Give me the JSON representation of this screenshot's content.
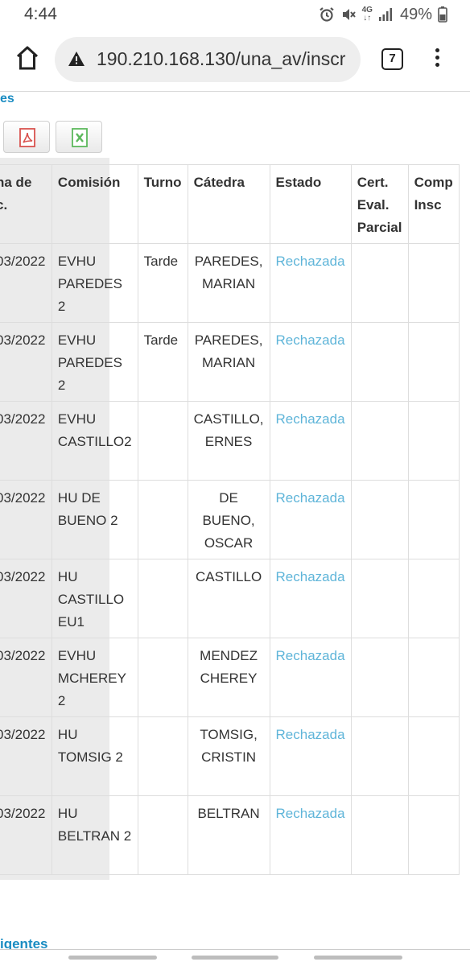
{
  "status_bar": {
    "time": "4:44",
    "network": "4G",
    "battery_percent": "49%",
    "icons": [
      "alarm-icon",
      "mute-icon",
      "network-4g-icon",
      "signal-icon",
      "battery-icon"
    ]
  },
  "browser": {
    "url": "190.210.168.130/una_av/inscr",
    "security_icon": "warning-triangle-icon",
    "tab_count": "7",
    "icons": [
      "home-icon",
      "tabs-icon",
      "more-vert-icon"
    ]
  },
  "page": {
    "top_link": "es",
    "bottom_link": "igentes",
    "export_buttons": [
      {
        "name": "pdf-export",
        "icon": "pdf-icon",
        "color": "#d9534f"
      },
      {
        "name": "excel-export",
        "icon": "excel-icon",
        "color": "#5cb85c"
      }
    ],
    "link_color": "#1a8cc2",
    "status_color": "#5fb5d9"
  },
  "table": {
    "headers": [
      "ha de\nc.",
      "Comisión",
      "Turno",
      "Cátedra",
      "Estado",
      "Cert.\nEval.\nParcial",
      "Comp\nInsc"
    ],
    "rows": [
      {
        "fecha": "03/2022",
        "comision": "EVHU PAREDES 2",
        "turno": "Tarde",
        "catedra": "PAREDES, MARIAN",
        "estado": "Rechazada",
        "cert": "",
        "comp": ""
      },
      {
        "fecha": "03/2022",
        "comision": "EVHU PAREDES 2",
        "turno": "Tarde",
        "catedra": "PAREDES, MARIAN",
        "estado": "Rechazada",
        "cert": "",
        "comp": ""
      },
      {
        "fecha": "03/2022",
        "comision": "EVHU CASTILLO2",
        "turno": "",
        "catedra": "CASTILLO, ERNES",
        "estado": "Rechazada",
        "cert": "",
        "comp": ""
      },
      {
        "fecha": "03/2022",
        "comision": "HU DE BUENO 2",
        "turno": "",
        "catedra": "DE BUENO, OSCAR",
        "estado": "Rechazada",
        "cert": "",
        "comp": ""
      },
      {
        "fecha": "03/2022",
        "comision": "HU CASTILLO EU1",
        "turno": "",
        "catedra": "CASTILLO",
        "estado": "Rechazada",
        "cert": "",
        "comp": ""
      },
      {
        "fecha": "03/2022",
        "comision": "EVHU MCHEREY 2",
        "turno": "",
        "catedra": "MENDEZ CHEREY",
        "estado": "Rechazada",
        "cert": "",
        "comp": ""
      },
      {
        "fecha": "03/2022",
        "comision": "HU TOMSIG 2",
        "turno": "",
        "catedra": "TOMSIG, CRISTIN",
        "estado": "Rechazada",
        "cert": "",
        "comp": ""
      },
      {
        "fecha": "03/2022",
        "comision": "HU BELTRAN 2",
        "turno": "",
        "catedra": "BELTRAN",
        "estado": "Rechazada",
        "cert": "",
        "comp": ""
      }
    ]
  }
}
